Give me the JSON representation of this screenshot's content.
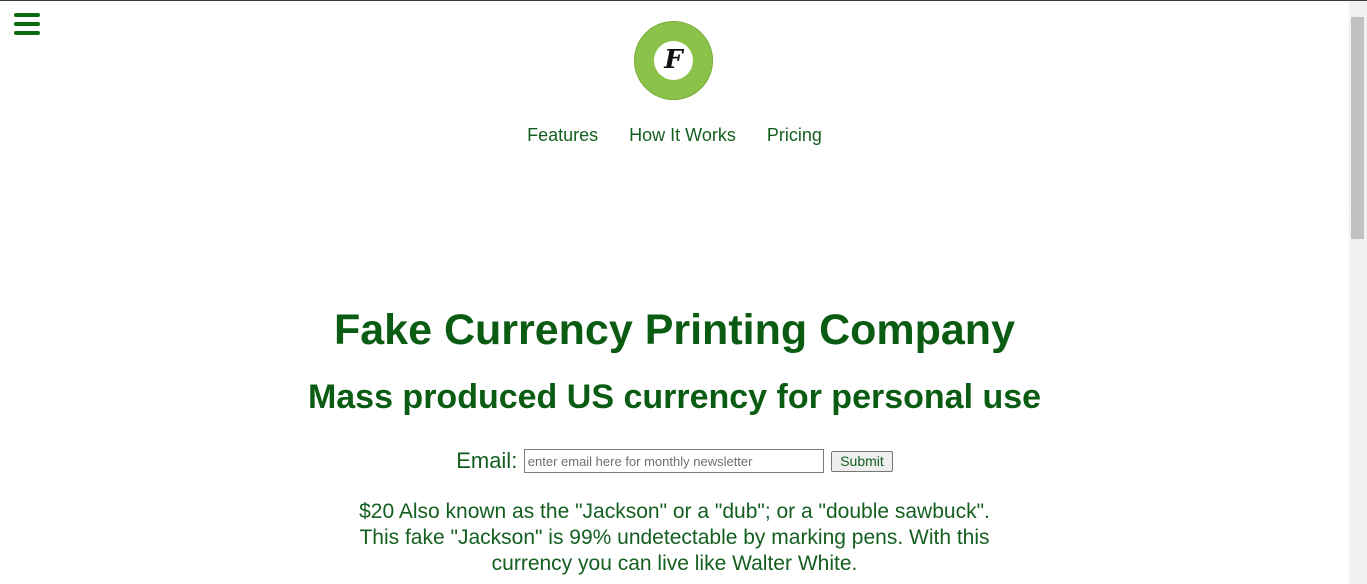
{
  "header": {
    "menu_icon": "hamburger-menu-icon",
    "logo": {
      "letter": "F",
      "color": "#8bc34a"
    },
    "nav": [
      {
        "label": "Features"
      },
      {
        "label": "How It Works"
      },
      {
        "label": "Pricing"
      }
    ]
  },
  "hero": {
    "title": "Fake Currency Printing Company",
    "subtitle": "Mass produced US currency for personal use"
  },
  "newsletter": {
    "label": "Email:",
    "placeholder": "enter email here for monthly newsletter",
    "submit_label": "Submit"
  },
  "description": "$20 Also known as the \"Jackson\" or a \"dub\"; or a \"double sawbuck\". This fake \"Jackson\" is 99% undetectable by marking pens. With this currency you can live like Walter White.",
  "colors": {
    "accent": "#0b5c13",
    "nav_text": "#135f1f",
    "logo_green": "#8bc34a"
  }
}
